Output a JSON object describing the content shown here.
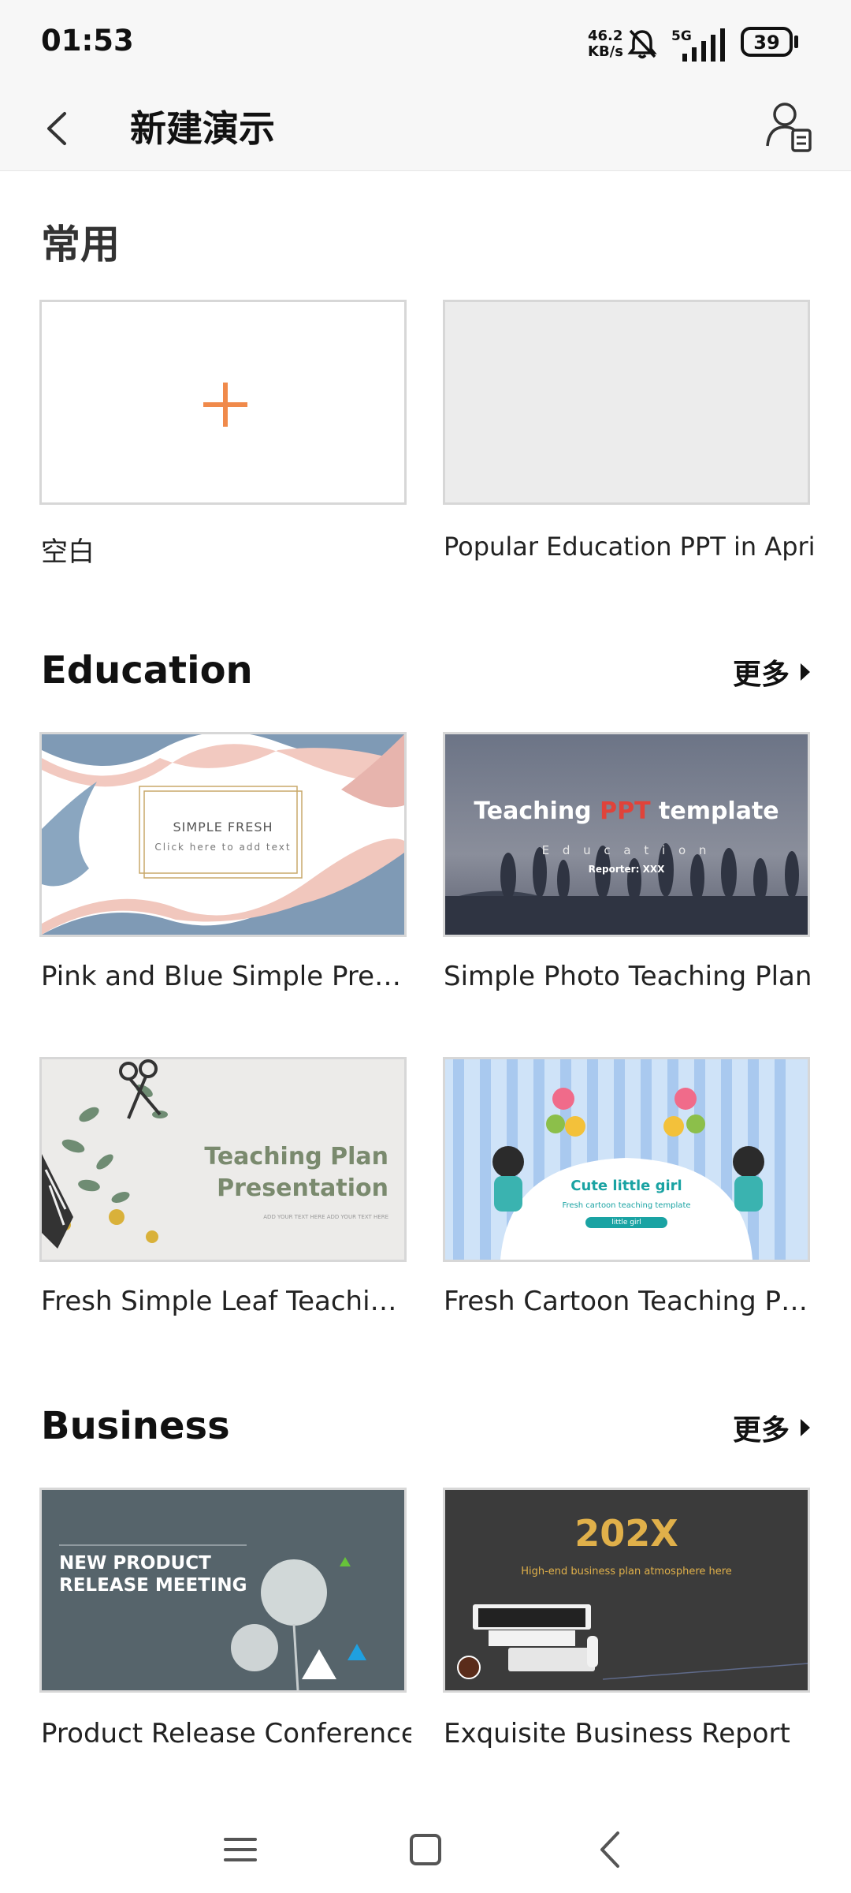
{
  "status_bar": {
    "time": "01:53",
    "net_speed_value": "46.2",
    "net_speed_unit": "KB/s",
    "network": "5G",
    "battery": "39"
  },
  "header": {
    "title": "新建演示"
  },
  "sections": {
    "common": {
      "title": "常用",
      "items": [
        {
          "label": "空白"
        },
        {
          "label": "Popular Education PPT in April"
        }
      ]
    },
    "education": {
      "title": "Education",
      "more_label": "更多",
      "items": [
        {
          "label": "Pink and Blue Simple Pre…",
          "thumb_line1": "SIMPLE FRESH",
          "thumb_line2": "Click here to add text"
        },
        {
          "label": "Simple Photo Teaching Plan",
          "thumb_title_a": "Teaching ",
          "thumb_title_b": "PPT",
          "thumb_title_c": " template",
          "thumb_sub": "E d u c a t i o n",
          "thumb_reporter": "Reporter: XXX"
        },
        {
          "label": "Fresh Simple Leaf Teachi…",
          "thumb_line1": "Teaching Plan",
          "thumb_line2": "Presentation",
          "thumb_line3": "ADD YOUR TEXT HERE  ADD YOUR TEXT HERE"
        },
        {
          "label": "Fresh Cartoon Teaching P…",
          "thumb_title": "Cute little girl",
          "thumb_sub": "Fresh cartoon teaching template",
          "thumb_btn": "little girl"
        }
      ]
    },
    "business": {
      "title": "Business",
      "more_label": "更多",
      "items": [
        {
          "label": "Product Release Conference",
          "thumb_line1": "NEW PRODUCT",
          "thumb_line2": "RELEASE MEETING"
        },
        {
          "label": "Exquisite Business Report",
          "thumb_title": "202X",
          "thumb_sub": "High-end business plan atmosphere here"
        }
      ]
    }
  },
  "colors": {
    "accent_orange": "#f08a4b",
    "edu_photo_red": "#e0433a",
    "teal": "#1aa3a3",
    "gold": "#e0b04a"
  }
}
